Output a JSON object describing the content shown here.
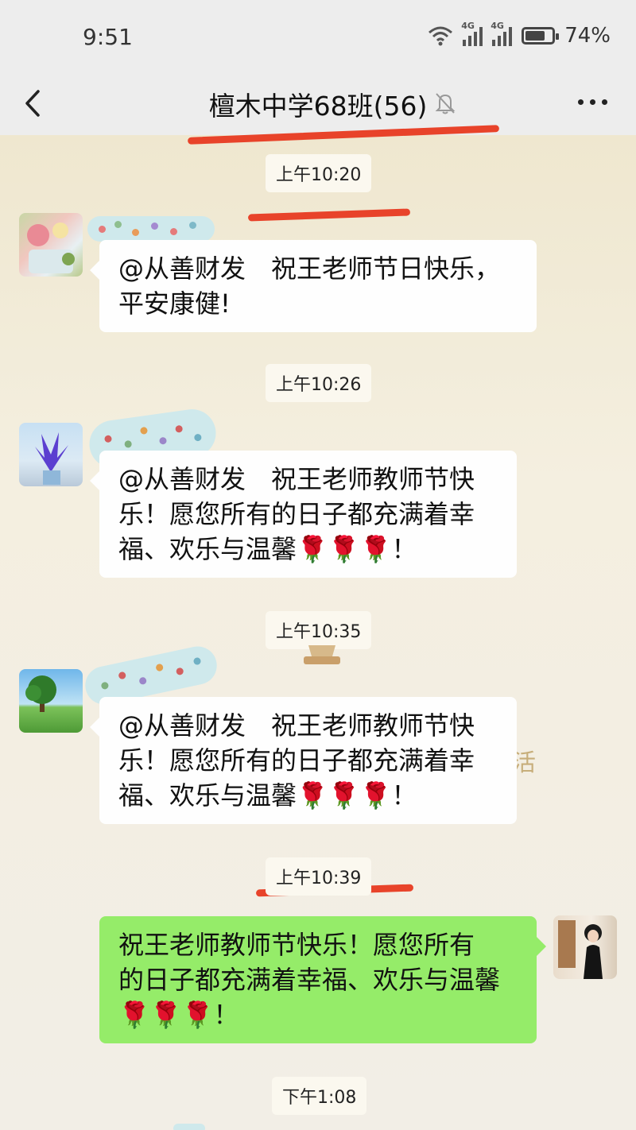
{
  "status": {
    "time": "9:51",
    "net1": "4G",
    "net2": "4G",
    "battery": "74%",
    "battery_level": 0.74
  },
  "header": {
    "title": "檀木中学68班(56)",
    "back_icon": "chevron-left-icon",
    "mute_icon": "bell-off-icon",
    "more_icon": "more-horizontal-icon"
  },
  "messages": [
    {
      "time": "上午10:20",
      "sender": "",
      "text": "@从善财发　祝王老师节日快乐，平安康健!"
    },
    {
      "time": "上午10:26",
      "sender": "",
      "text": "@从善财发　祝王老师教师节快乐！愿您所有的日子都充满着幸福、欢乐与温馨🌹🌹🌹！"
    },
    {
      "time": "上午10:35",
      "sender": "",
      "text": "@从善财发　祝王老师教师节快乐！愿您所有的日子都充满着幸福、欢乐与温馨🌹🌹🌹！"
    },
    {
      "time": "上午10:39",
      "sender": "me",
      "text": "  祝王老师教师节快乐！愿您所有的日子都充满着幸福、欢乐与温馨🌹🌹🌹！"
    },
    {
      "time": "下午1:08"
    }
  ],
  "lines": {
    "m1_l1": "@从善财发　祝王老师节日快乐，",
    "m1_l2": "平安康健!",
    "m2_l1": "@从善财发　祝王老师教师节快",
    "m2_l2": "乐！愿您所有的日子都充满着幸",
    "m2_l3": "福、欢乐与温馨",
    "m3_l1": "@从善财发　祝王老师教师节快",
    "m3_l2": "乐！愿您所有的日子都充满着幸",
    "m3_l3": "福、欢乐与温馨",
    "m4_l1": "  祝王老师教师节快乐！愿您所有",
    "m4_l2": "的日子都充满着幸福、欢乐与温馨",
    "roses": "🌹🌹🌹",
    "exclaim": "！"
  },
  "background_text": "活",
  "colors": {
    "header_bg": "#ededed",
    "my_bubble": "#95ec69",
    "other_bubble": "#fefefe",
    "annotation_red": "#e8432a"
  }
}
